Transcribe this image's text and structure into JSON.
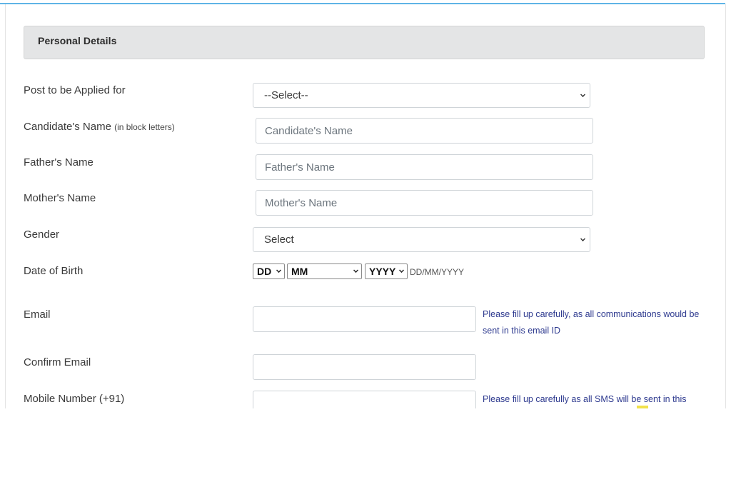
{
  "section": {
    "title": "Personal Details"
  },
  "fields": {
    "post": {
      "label": "Post to be Applied for",
      "selected": "--Select--"
    },
    "candidate_name": {
      "label": "Candidate's Name",
      "label_note": "(in block letters)",
      "placeholder": "Candidate's Name"
    },
    "father_name": {
      "label": "Father's Name",
      "placeholder": "Father's Name"
    },
    "mother_name": {
      "label": "Mother's Name",
      "placeholder": "Mother's Name"
    },
    "gender": {
      "label": "Gender",
      "selected": "Select"
    },
    "dob": {
      "label": "Date of Birth",
      "day": "DD",
      "month": "MM",
      "year": "YYYY",
      "hint": "DD/MM/YYYY"
    },
    "email": {
      "label": "Email",
      "value": "",
      "help_line1": "Please fill up carefully, as all communications would be",
      "help_line2": "sent in this email ID"
    },
    "confirm_email": {
      "label": "Confirm Email",
      "value": ""
    },
    "mobile": {
      "label": "Mobile Number (+91)",
      "value": "",
      "help_line1": "Please fill up carefully as all SMS will be sent in this"
    }
  },
  "colors": {
    "accent_rule": "#5fb4e6",
    "help_text": "#2e3a8f",
    "header_bg": "#e4e5e6"
  }
}
